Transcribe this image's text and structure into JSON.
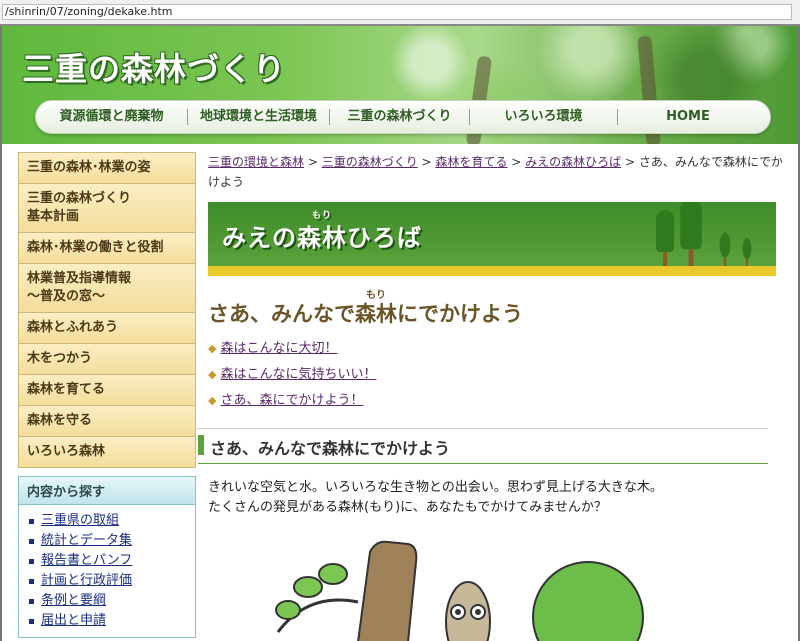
{
  "browser": {
    "url": "/shinrin/07/zoning/dekake.htm"
  },
  "header": {
    "site_title": "三重の森林づくり"
  },
  "global_nav": [
    {
      "label": "資源循環と廃棄物"
    },
    {
      "label": "地球環境と生活環境"
    },
    {
      "label": "三重の森林づくり"
    },
    {
      "label": "いろいろ環境"
    },
    {
      "label": "HOME"
    }
  ],
  "sidebar": {
    "items": [
      {
        "label": "三重の森林･林業の姿"
      },
      {
        "label": "三重の森林づくり",
        "label2": "基本計画"
      },
      {
        "label": "森林･林業の働きと役割"
      },
      {
        "label": "林業普及指導情報",
        "label2": "～普及の窓～"
      },
      {
        "label": "森林とふれあう"
      },
      {
        "label": "木をつかう"
      },
      {
        "label": "森林を育てる"
      },
      {
        "label": "森林を守る"
      },
      {
        "label": "いろいろ森林"
      }
    ],
    "search": {
      "heading": "内容から探す",
      "links": [
        {
          "label": "三重県の取組"
        },
        {
          "label": "統計とデータ集"
        },
        {
          "label": "報告書とパンフ"
        },
        {
          "label": "計画と行政評価"
        },
        {
          "label": "条例と要綱"
        },
        {
          "label": "届出と申請"
        }
      ]
    }
  },
  "breadcrumb": {
    "links": [
      {
        "label": "三重の環境と森林"
      },
      {
        "label": "三重の森林づくり"
      },
      {
        "label": "森林を育てる"
      },
      {
        "label": "みえの森林ひろば"
      }
    ],
    "separator": " > ",
    "current": "さあ、みんなで森林にでかけよう"
  },
  "banner": {
    "title_prefix": "みえの",
    "title_kanji": "森林",
    "title_ruby": "もり",
    "title_suffix": "ひろば"
  },
  "page_title": {
    "prefix": "さあ、みんなで",
    "kanji": "森林",
    "ruby": "もり",
    "suffix": "にでかけよう"
  },
  "page_links": [
    {
      "label": "森はこんなに大切！"
    },
    {
      "label": "森はこんなに気持ちいい！"
    },
    {
      "label": "さあ、森にでかけよう！"
    }
  ],
  "section_heading": "さあ、みんなで森林にでかけよう",
  "body": {
    "line1": "きれいな空気と水。いろいろな生き物との出会い。思わず見上げる大きな木。",
    "line2": "たくさんの発見がある森林(もり)に、あなたもでかけてみませんか？"
  },
  "colors": {
    "accent_green": "#5aa23c",
    "sidebar_gold": "#f3dd9a",
    "link_purple": "#5a2a6a"
  }
}
